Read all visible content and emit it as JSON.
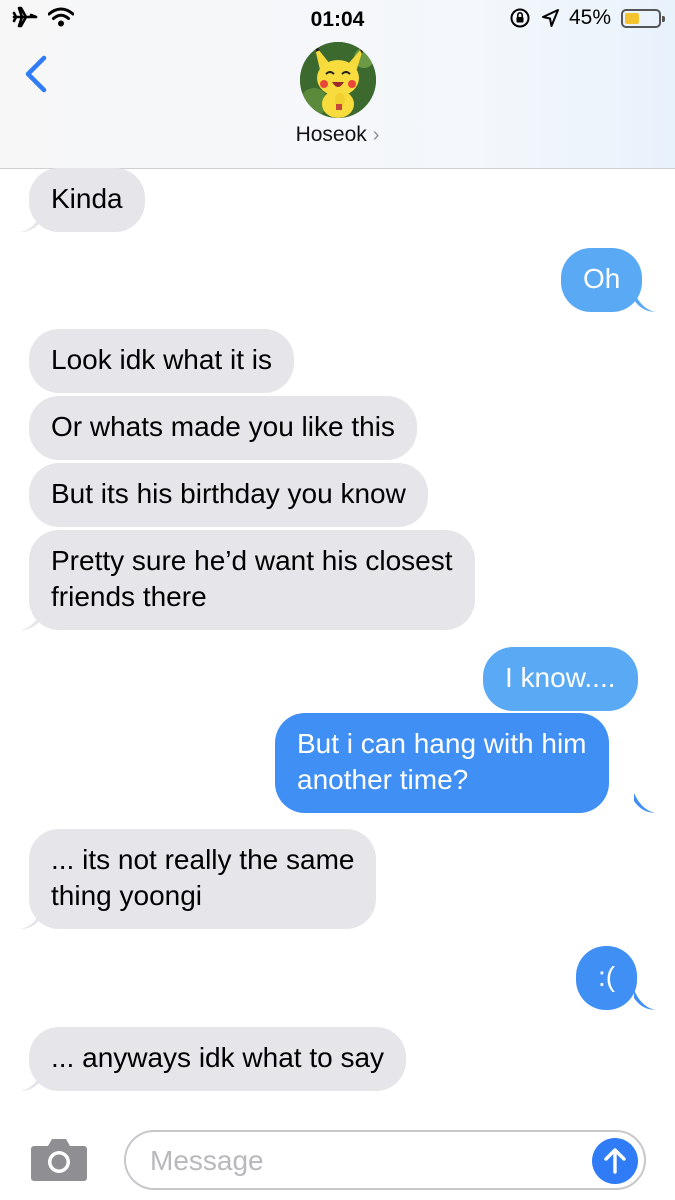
{
  "status_bar": {
    "time": "01:04",
    "battery_percent": "45%",
    "battery_level": 0.45,
    "icons": [
      "airplane-icon",
      "wifi-icon",
      "orientation-lock-icon",
      "location-icon",
      "battery-icon"
    ]
  },
  "header": {
    "contact_name": "Hoseok",
    "chevron": "›",
    "back_icon": "chevron-left-icon"
  },
  "messages": [
    {
      "side": "received",
      "text": "Kinda"
    },
    {
      "side": "sent",
      "text": "Oh"
    },
    {
      "side": "received",
      "text": "Look idk what it is"
    },
    {
      "side": "received",
      "text": "Or whats made you like this"
    },
    {
      "side": "received",
      "text": "But its his birthday you know"
    },
    {
      "side": "received",
      "lines": [
        "Pretty sure he’d want his closest",
        "friends there"
      ]
    },
    {
      "side": "sent",
      "text": "I know...."
    },
    {
      "side": "sent",
      "lines": [
        "But i can hang with him",
        "another time?"
      ]
    },
    {
      "side": "received",
      "lines": [
        "... its not really the same",
        "thing yoongi"
      ]
    },
    {
      "side": "sent",
      "text": ":("
    },
    {
      "side": "received",
      "text": "... anyways idk what to say"
    }
  ],
  "input_bar": {
    "placeholder": "Message",
    "camera_icon": "camera-icon",
    "send_icon": "arrow-up-icon"
  },
  "colors": {
    "received_bubble": "#e5e5ea",
    "sent_bubble_light": "#5aa9f5",
    "sent_bubble": "#3f8ff4",
    "accent": "#2f7cf6"
  }
}
